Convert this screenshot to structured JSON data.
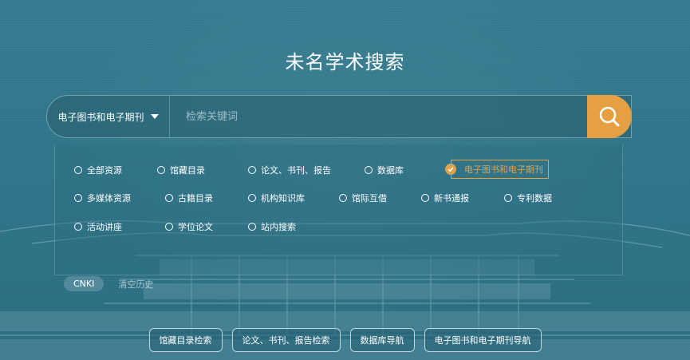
{
  "title": "未名学术搜索",
  "search": {
    "scope_label": "电子图书和电子期刊",
    "placeholder": "检索关键词"
  },
  "options": [
    {
      "label": "全部资源",
      "selected": false
    },
    {
      "label": "馆藏目录",
      "selected": false
    },
    {
      "label": "论文、书刊、报告",
      "selected": false
    },
    {
      "label": "数据库",
      "selected": false
    },
    {
      "label": "电子图书和电子期刊",
      "selected": true
    },
    {
      "label": "多媒体资源",
      "selected": false
    },
    {
      "label": "古籍目录",
      "selected": false
    },
    {
      "label": "机构知识库",
      "selected": false
    },
    {
      "label": "馆际互借",
      "selected": false
    },
    {
      "label": "新书通报",
      "selected": false
    },
    {
      "label": "专利数据",
      "selected": false
    },
    {
      "label": "活动讲座",
      "selected": false
    },
    {
      "label": "学位论文",
      "selected": false
    },
    {
      "label": "站内搜索",
      "selected": false
    }
  ],
  "history": {
    "item": "CNKI",
    "clear_label": "清空历史"
  },
  "quick_links": [
    "馆藏目录检索",
    "论文、书刊、报告检索",
    "数据库导航",
    "电子图书和电子期刊导航"
  ],
  "colors": {
    "background": "#2f7488",
    "accent": "#e4a043"
  },
  "icons": {
    "search": "search-icon",
    "dropdown": "caret-down-icon",
    "selected": "check-icon"
  }
}
